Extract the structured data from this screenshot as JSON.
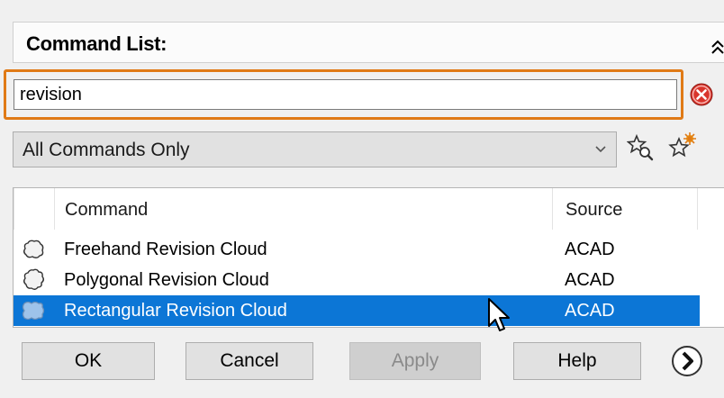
{
  "panel": {
    "title": "Command List:"
  },
  "search": {
    "value": "revision"
  },
  "filter": {
    "selected": "All Commands Only"
  },
  "table": {
    "columns": {
      "command": "Command",
      "source": "Source"
    },
    "rows": [
      {
        "name": "Freehand Revision Cloud",
        "source": "ACAD",
        "icon": "freehand-cloud-icon",
        "selected": false
      },
      {
        "name": "Polygonal Revision Cloud",
        "source": "ACAD",
        "icon": "polygonal-cloud-icon",
        "selected": false
      },
      {
        "name": "Rectangular Revision Cloud",
        "source": "ACAD",
        "icon": "rectangular-cloud-icon",
        "selected": true
      }
    ]
  },
  "buttons": {
    "ok": "OK",
    "cancel": "Cancel",
    "apply": "Apply",
    "help": "Help"
  },
  "colors": {
    "highlight": "#e07a16",
    "selection": "#0c76d6",
    "clear_icon": "#d9342b"
  }
}
